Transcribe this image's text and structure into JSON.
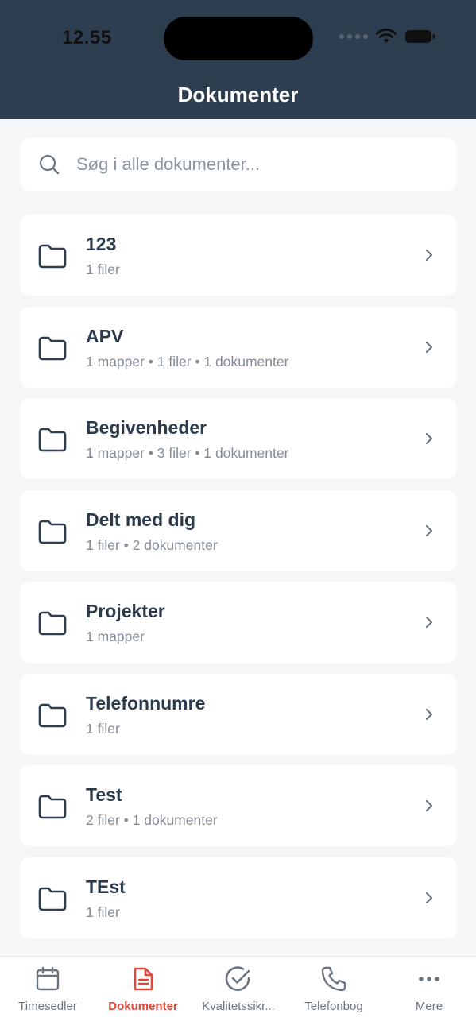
{
  "status_bar": {
    "time": "12.55"
  },
  "header": {
    "title": "Dokumenter"
  },
  "search": {
    "placeholder": "Søg i alle dokumenter..."
  },
  "folders": [
    {
      "name": "123",
      "meta": "1 filer"
    },
    {
      "name": "APV",
      "meta": "1 mapper • 1 filer • 1 dokumenter"
    },
    {
      "name": "Begivenheder",
      "meta": "1 mapper • 3 filer • 1 dokumenter"
    },
    {
      "name": "Delt med dig",
      "meta": "1 filer • 2 dokumenter"
    },
    {
      "name": "Projekter",
      "meta": "1 mapper"
    },
    {
      "name": "Telefonnumre",
      "meta": "1 filer"
    },
    {
      "name": "Test",
      "meta": "2 filer • 1 dokumenter"
    },
    {
      "name": "TEst",
      "meta": "1 filer"
    }
  ],
  "tabbar": {
    "tabs": [
      {
        "label": "Timesedler",
        "icon": "calendar-icon",
        "active": false
      },
      {
        "label": "Dokumenter",
        "icon": "document-icon",
        "active": true
      },
      {
        "label": "Kvalitetssikr...",
        "icon": "check-circle-icon",
        "active": false
      },
      {
        "label": "Telefonbog",
        "icon": "phone-icon",
        "active": false
      },
      {
        "label": "Mere",
        "icon": "more-icon",
        "active": false
      }
    ]
  },
  "colors": {
    "header_bg": "#2e3e51",
    "accent": "#e0483a",
    "text_primary": "#2b3a4c",
    "text_secondary": "#838c97",
    "background": "#f5f6f8"
  }
}
